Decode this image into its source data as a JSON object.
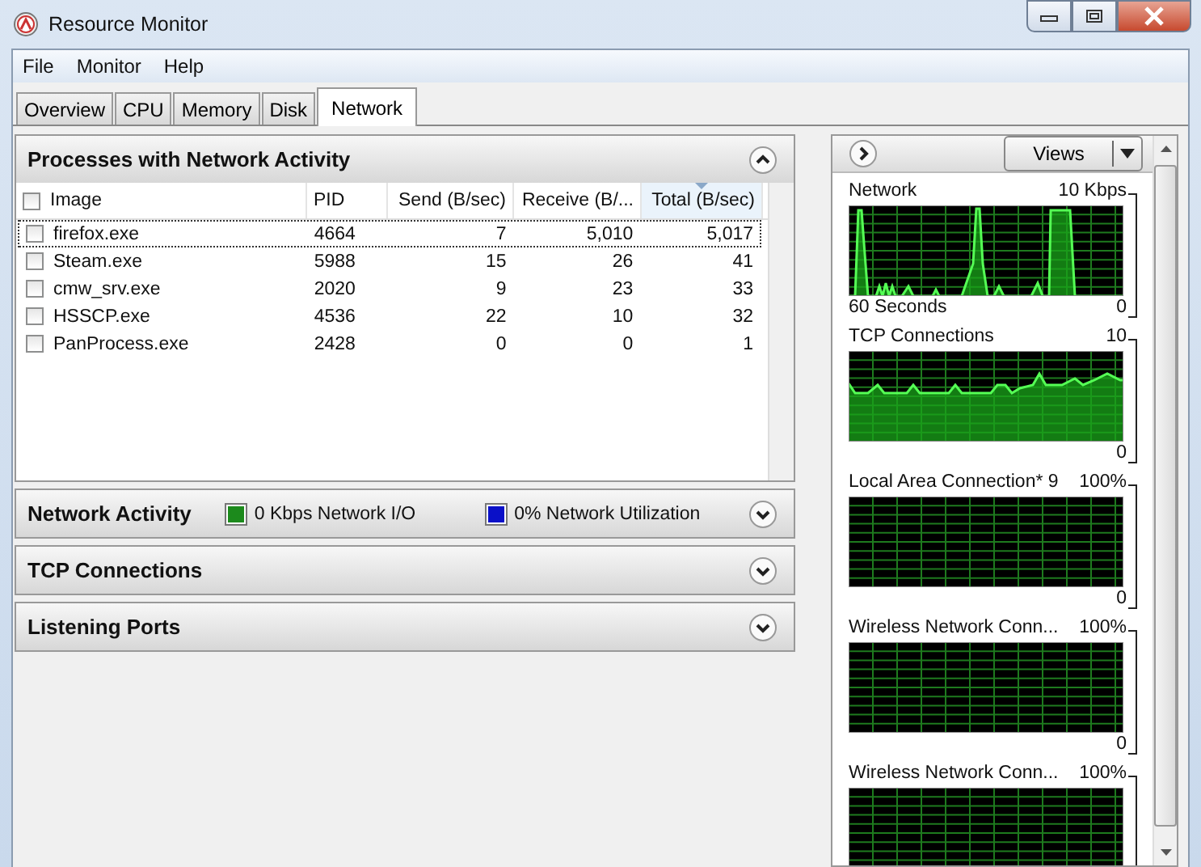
{
  "window": {
    "title": "Resource Monitor"
  },
  "menu": [
    "File",
    "Monitor",
    "Help"
  ],
  "tabs": [
    {
      "label": "Overview",
      "selected": false
    },
    {
      "label": "CPU",
      "selected": false
    },
    {
      "label": "Memory",
      "selected": false
    },
    {
      "label": "Disk",
      "selected": false
    },
    {
      "label": "Network",
      "selected": true
    }
  ],
  "processes": {
    "title": "Processes with Network Activity",
    "expanded": true,
    "columns": [
      {
        "label": "Image",
        "sorted": false
      },
      {
        "label": "PID",
        "sorted": false
      },
      {
        "label": "Send (B/sec)",
        "sorted": false
      },
      {
        "label": "Receive (B/...",
        "sorted": false
      },
      {
        "label": "Total (B/sec)",
        "sorted": true
      }
    ],
    "rows": [
      {
        "checked": false,
        "focused": true,
        "cells": [
          "firefox.exe",
          "4664",
          "7",
          "5,010",
          "5,017"
        ]
      },
      {
        "checked": false,
        "focused": false,
        "cells": [
          "Steam.exe",
          "5988",
          "15",
          "26",
          "41"
        ]
      },
      {
        "checked": false,
        "focused": false,
        "cells": [
          "cmw_srv.exe",
          "2020",
          "9",
          "23",
          "33"
        ]
      },
      {
        "checked": false,
        "focused": false,
        "cells": [
          "HSSCP.exe",
          "4536",
          "22",
          "10",
          "32"
        ]
      },
      {
        "checked": false,
        "focused": false,
        "cells": [
          "PanProcess.exe",
          "2428",
          "0",
          "0",
          "1"
        ]
      }
    ]
  },
  "sections": [
    {
      "title": "Network Activity",
      "expanded": false,
      "legend": [
        {
          "text": "0 Kbps Network I/O",
          "color": "#1c8a1c"
        },
        {
          "text": "0% Network Utilization",
          "color": "#0a10c8"
        }
      ]
    },
    {
      "title": "TCP Connections",
      "expanded": false
    },
    {
      "title": "Listening Ports",
      "expanded": false
    }
  ],
  "graphs_pane": {
    "views_button": "Views",
    "graphs": [
      {
        "title": "Network",
        "max": "10 Kbps",
        "kind": "traffic",
        "time": "60 Seconds",
        "min": "0"
      },
      {
        "title": "TCP Connections",
        "max": "10",
        "kind": "connections",
        "min": "0"
      },
      {
        "title": "Local Area Connection* 9",
        "max": "100%",
        "kind": "idle",
        "min": "0"
      },
      {
        "title": "Wireless Network Conn...",
        "max": "100%",
        "kind": "idle",
        "min": "0"
      },
      {
        "title": "Wireless Network Conn...",
        "max": "100%",
        "kind": "idle"
      }
    ]
  }
}
